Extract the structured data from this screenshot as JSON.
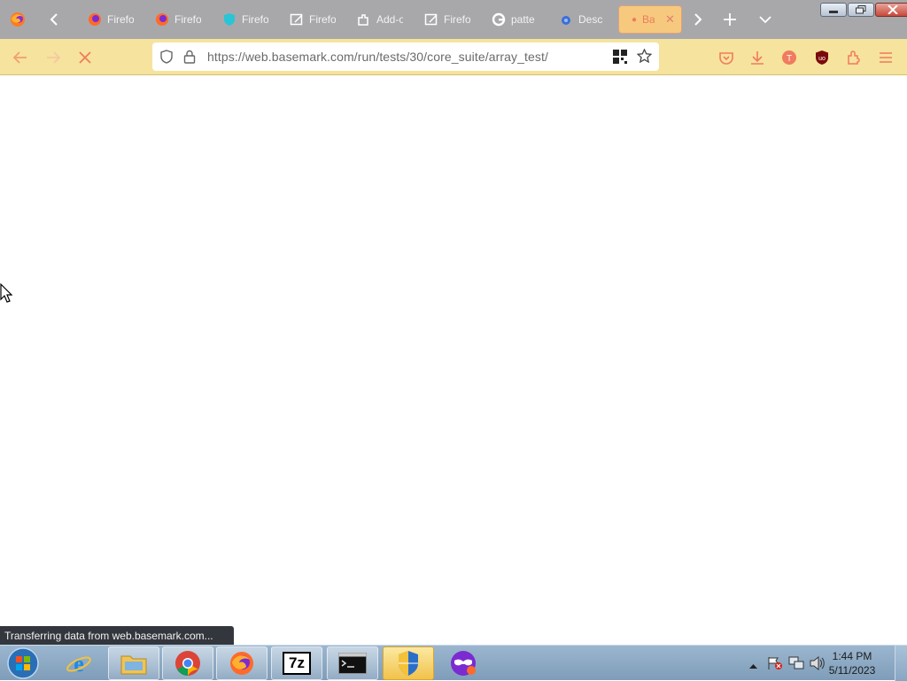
{
  "browser": {
    "tabs": [
      {
        "label": "Firefo",
        "icon": "firefox-icon"
      },
      {
        "label": "Firefo",
        "icon": "firefox-icon"
      },
      {
        "label": "Firefo",
        "icon": "shield-teal-icon"
      },
      {
        "label": "Firefo",
        "icon": "edit-document-icon"
      },
      {
        "label": "Add-o",
        "icon": "addon-icon"
      },
      {
        "label": "Firefo",
        "icon": "edit-document-icon"
      },
      {
        "label": "patte",
        "icon": "google-icon"
      },
      {
        "label": "Desc",
        "icon": "deseat-icon"
      },
      {
        "label": "Ba",
        "icon": "loading-dot-icon",
        "active": true
      }
    ],
    "url": "https://web.basemark.com/run/tests/30/core_suite/array_test/",
    "status_text": "Transferring data from web.basemark.com..."
  },
  "taskbar": {
    "items": [
      "internet-explorer-icon",
      "file-explorer-icon",
      "chrome-icon",
      "firefox-icon",
      "7zip-icon",
      "cmd-icon",
      "security-shield-icon",
      "privacy-mask-icon"
    ],
    "seven_zip_label": "7z",
    "clock_time": "1:44 PM",
    "clock_date": "5/11/2023"
  },
  "colors": {
    "tabbar_bg": "#a8a8ab",
    "navbar_bg": "#f6e39d",
    "active_tab_bg": "#f6c97e",
    "accent": "#f07b5e"
  }
}
